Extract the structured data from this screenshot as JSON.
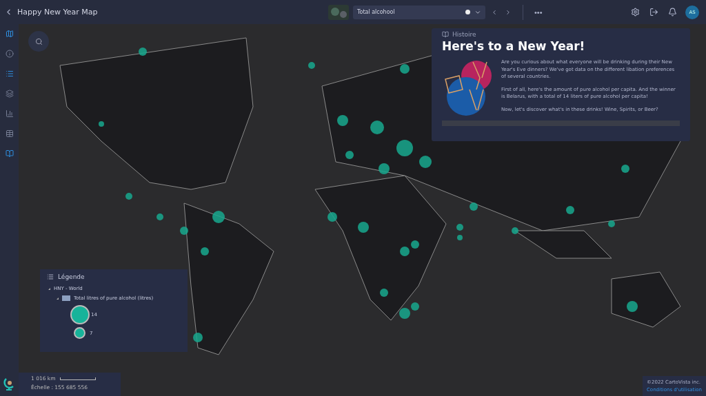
{
  "header": {
    "title": "Happy New Year Map",
    "layer_select": {
      "value": "Total alcohool"
    },
    "more": "•••",
    "avatar": "AS"
  },
  "sidebar": {
    "items": [
      {
        "kind": "map",
        "active": true
      },
      {
        "kind": "info",
        "active": false
      },
      {
        "kind": "list",
        "active": true
      },
      {
        "kind": "layers",
        "active": false
      },
      {
        "kind": "chart",
        "active": false
      },
      {
        "kind": "table",
        "active": false
      },
      {
        "kind": "story",
        "active": true
      }
    ]
  },
  "story": {
    "label": "Histoire",
    "title": "Here's to a New Year!",
    "paragraphs": [
      "Are you curious about what everyone will be drinking during their New Year's Eve dinners? We've got data on the different libation preferences of several countries.",
      "First of all, here's the amount of pure alcohol per capita. And the winner is Belarus, with a total of 14 liters of pure alcohol per capita!",
      "Now, let's discover what's in these drinks! Wine, Spirits, or Beer?"
    ]
  },
  "legend": {
    "title": "Légende",
    "group": "HNY - World",
    "layer": "Total litres of pure alcohol (litres)",
    "sizes": [
      {
        "label": "14",
        "kind": "large"
      },
      {
        "label": "7",
        "kind": "small"
      }
    ]
  },
  "scale": {
    "distance": "1 016 km",
    "ratio": "Échelle : 155 685 556"
  },
  "footer": {
    "copyright": "©2022 CartoVista inc.",
    "link": "Conditions d'utilisation"
  }
}
